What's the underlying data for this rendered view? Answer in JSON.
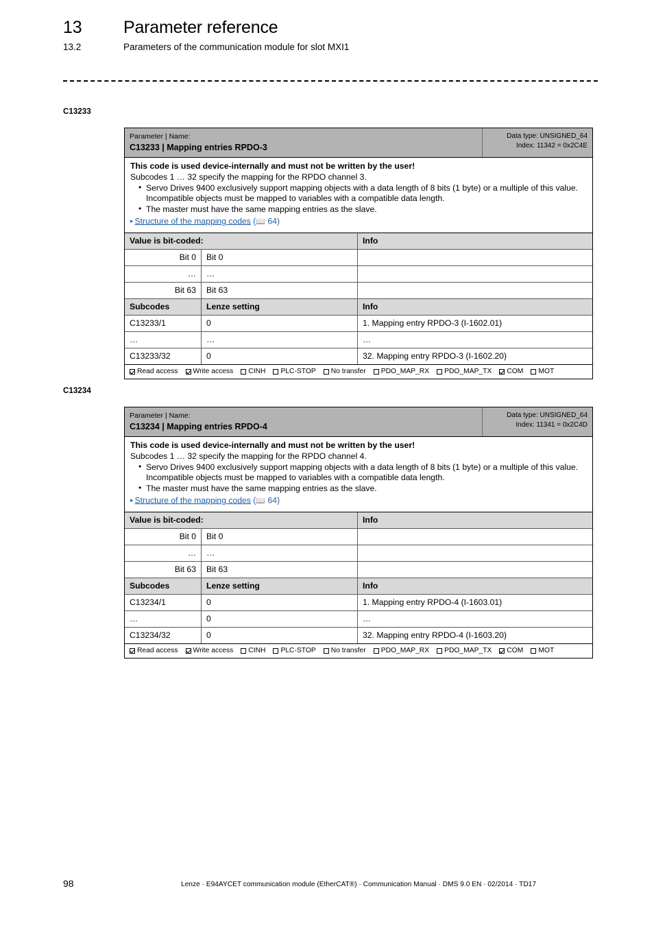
{
  "header": {
    "chapter_number": "13",
    "chapter_title": "Parameter reference",
    "section_number": "13.2",
    "section_title": "Parameters of the communication module for slot MXI1"
  },
  "footer": {
    "page_number": "98",
    "imprint": "Lenze · E94AYCET communication module (EtherCAT®) · Communication Manual · DMS 9.0 EN · 02/2014 · TD17"
  },
  "colors": {
    "table_header_gray": "#b3b3b3",
    "subheader_gray": "#d8d8d8",
    "link_blue": "#1f5fa9",
    "border_black": "#000000",
    "border_gray": "#5a5a5a"
  },
  "parameters": [
    {
      "margin_code": "C13233",
      "head": {
        "kicker": "Parameter | Name:",
        "name": "C13233 | Mapping entries RPDO-3",
        "data_type": "Data type: UNSIGNED_64",
        "index": "Index: 11342 = 0x2C4E"
      },
      "description": {
        "warning": "This code is used device-internally and must not be written by the user!",
        "intro": "Subcodes 1 … 32 specify the mapping for the RPDO channel 3.",
        "bullets": [
          "Servo Drives 9400 exclusively support mapping objects with a data length of 8 bits (1 byte) or a multiple of this value. Incompatible objects must be mapped to variables with a compatible data length.",
          "The master must have the same mapping entries as the slave."
        ],
        "xref_link": "Structure of the mapping codes",
        "xref_page": "64",
        "xref_arrow": "▸",
        "xref_book_icon": "📖"
      },
      "bit_table": {
        "header": [
          "Value is bit-coded:",
          "Info"
        ],
        "rows": [
          [
            "Bit 0",
            "Bit 0",
            ""
          ],
          [
            "…",
            "…",
            ""
          ],
          [
            "Bit 63",
            "Bit 63",
            ""
          ]
        ]
      },
      "subcode_table": {
        "header": [
          "Subcodes",
          "Lenze setting",
          "Info"
        ],
        "rows": [
          [
            "C13233/1",
            "0",
            "1. Mapping entry RPDO-3 (I-1602.01)"
          ],
          [
            "…",
            "…",
            "…"
          ],
          [
            "C13233/32",
            "0",
            "32. Mapping entry RPDO-3 (I-1602.20)"
          ]
        ]
      },
      "access": [
        {
          "label": "Read access",
          "checked": true
        },
        {
          "label": "Write access",
          "checked": true
        },
        {
          "label": "CINH",
          "checked": false
        },
        {
          "label": "PLC-STOP",
          "checked": false
        },
        {
          "label": "No transfer",
          "checked": false
        },
        {
          "label": "PDO_MAP_RX",
          "checked": false
        },
        {
          "label": "PDO_MAP_TX",
          "checked": false
        },
        {
          "label": "COM",
          "checked": true
        },
        {
          "label": "MOT",
          "checked": false
        }
      ]
    },
    {
      "margin_code": "C13234",
      "head": {
        "kicker": "Parameter | Name:",
        "name": "C13234 | Mapping entries RPDO-4",
        "data_type": "Data type: UNSIGNED_64",
        "index": "Index: 11341 = 0x2C4D"
      },
      "description": {
        "warning": "This code is used device-internally and must not be written by the user!",
        "intro": "Subcodes 1 … 32 specify the mapping for the RPDO channel 4.",
        "bullets": [
          "Servo Drives 9400 exclusively support mapping objects with a data length of 8 bits (1 byte) or a multiple of this value. Incompatible objects must be mapped to variables with a compatible data length.",
          "The master must have the same mapping entries as the slave."
        ],
        "xref_link": "Structure of the mapping codes",
        "xref_page": "64",
        "xref_arrow": "▸",
        "xref_book_icon": "📖"
      },
      "bit_table": {
        "header": [
          "Value is bit-coded:",
          "Info"
        ],
        "rows": [
          [
            "Bit 0",
            "Bit 0",
            ""
          ],
          [
            "…",
            "…",
            ""
          ],
          [
            "Bit 63",
            "Bit 63",
            ""
          ]
        ]
      },
      "subcode_table": {
        "header": [
          "Subcodes",
          "Lenze setting",
          "Info"
        ],
        "rows": [
          [
            "C13234/1",
            "0",
            "1. Mapping entry RPDO-4 (I-1603.01)"
          ],
          [
            "…",
            "0",
            "…"
          ],
          [
            "C13234/32",
            "0",
            "32. Mapping entry RPDO-4 (I-1603.20)"
          ]
        ]
      },
      "access": [
        {
          "label": "Read access",
          "checked": true
        },
        {
          "label": "Write access",
          "checked": true
        },
        {
          "label": "CINH",
          "checked": false
        },
        {
          "label": "PLC-STOP",
          "checked": false
        },
        {
          "label": "No transfer",
          "checked": false
        },
        {
          "label": "PDO_MAP_RX",
          "checked": false
        },
        {
          "label": "PDO_MAP_TX",
          "checked": false
        },
        {
          "label": "COM",
          "checked": true
        },
        {
          "label": "MOT",
          "checked": false
        }
      ]
    }
  ]
}
